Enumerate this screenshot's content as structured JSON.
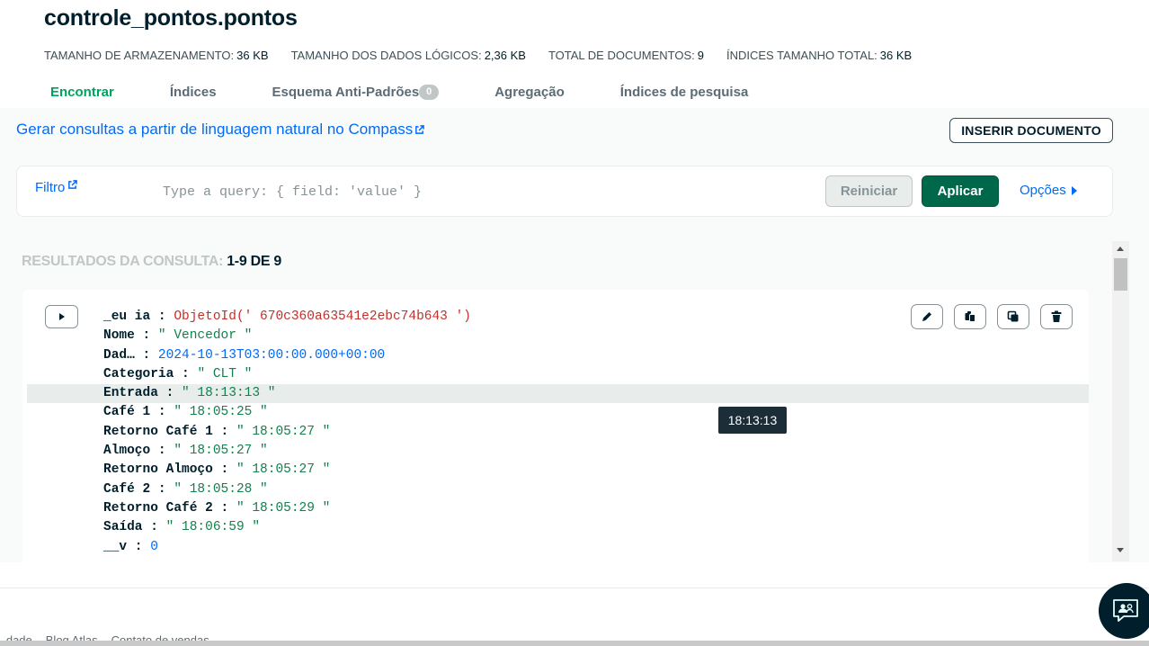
{
  "collection": {
    "title": "controle_pontos.pontos",
    "stats": [
      {
        "label": "TAMANHO DE ARMAZENAMENTO:",
        "value": "36 KB"
      },
      {
        "label": "TAMANHO DOS DADOS LÓGICOS:",
        "value": "2,36 KB"
      },
      {
        "label": "TOTAL DE DOCUMENTOS:",
        "value": "9"
      },
      {
        "label": "ÍNDICES TAMANHO TOTAL:",
        "value": "36 KB"
      }
    ]
  },
  "tabs": [
    {
      "label": "Encontrar",
      "active": true
    },
    {
      "label": "Índices"
    },
    {
      "label": "Esquema Anti-Padrões",
      "badge": "0"
    },
    {
      "label": "Agregação"
    },
    {
      "label": "Índices de pesquisa"
    }
  ],
  "nl_query_link": "Gerar consultas a partir de linguagem natural no Compass",
  "insert_button": "INSERIR DOCUMENTO",
  "filter": {
    "label": "Filtro",
    "placeholder": "Type a query: { field: 'value' }",
    "reset_button": "Reiniciar",
    "apply_button": "Aplicar",
    "options_button": "Opções"
  },
  "results": {
    "label": "RESULTADOS DA CONSULTA:",
    "count": "1-9 DE 9"
  },
  "document": {
    "fields": [
      {
        "key": "_eu ia",
        "value": "ObjetoId(' 670c360a63541e2ebc74b643 ')",
        "type": "oid"
      },
      {
        "key": "Nome",
        "value": "\" Vencedor \"",
        "type": "str"
      },
      {
        "key": "Dad…",
        "value": "2024-10-13T03:00:00.000+00:00",
        "type": "date"
      },
      {
        "key": "Categoria",
        "value": "\" CLT \"",
        "type": "str"
      },
      {
        "key": "Entrada",
        "value": "\" 18:13:13 \"",
        "type": "str",
        "hover": true
      },
      {
        "key": "Café 1",
        "value": "\" 18:05:25 \"",
        "type": "str"
      },
      {
        "key": "Retorno Café 1",
        "value": "\" 18:05:27 \"",
        "type": "str"
      },
      {
        "key": "Almoço",
        "value": "\" 18:05:27 \"",
        "type": "str"
      },
      {
        "key": "Retorno Almoço",
        "value": "\" 18:05:27 \"",
        "type": "str"
      },
      {
        "key": "Café 2",
        "value": "\" 18:05:28 \"",
        "type": "str"
      },
      {
        "key": "Retorno Café 2",
        "value": "\" 18:05:29 \"",
        "type": "str"
      },
      {
        "key": "Saída",
        "value": "\" 18:06:59 \"",
        "type": "str"
      },
      {
        "key": "__v",
        "value": "0",
        "type": "num"
      }
    ],
    "actions": [
      "edit-icon",
      "copy-icon",
      "clone-icon",
      "delete-icon"
    ]
  },
  "tooltip": "18:13:13",
  "footer": {
    "links": [
      "...dade",
      "Blog Atlas",
      "Contato de vendas"
    ]
  },
  "colors": {
    "accent_green": "#00a35c",
    "apply_green": "#00684a",
    "link_blue": "#016bf8",
    "string_green": "#12824d",
    "objectid_red": "#c2302b"
  }
}
